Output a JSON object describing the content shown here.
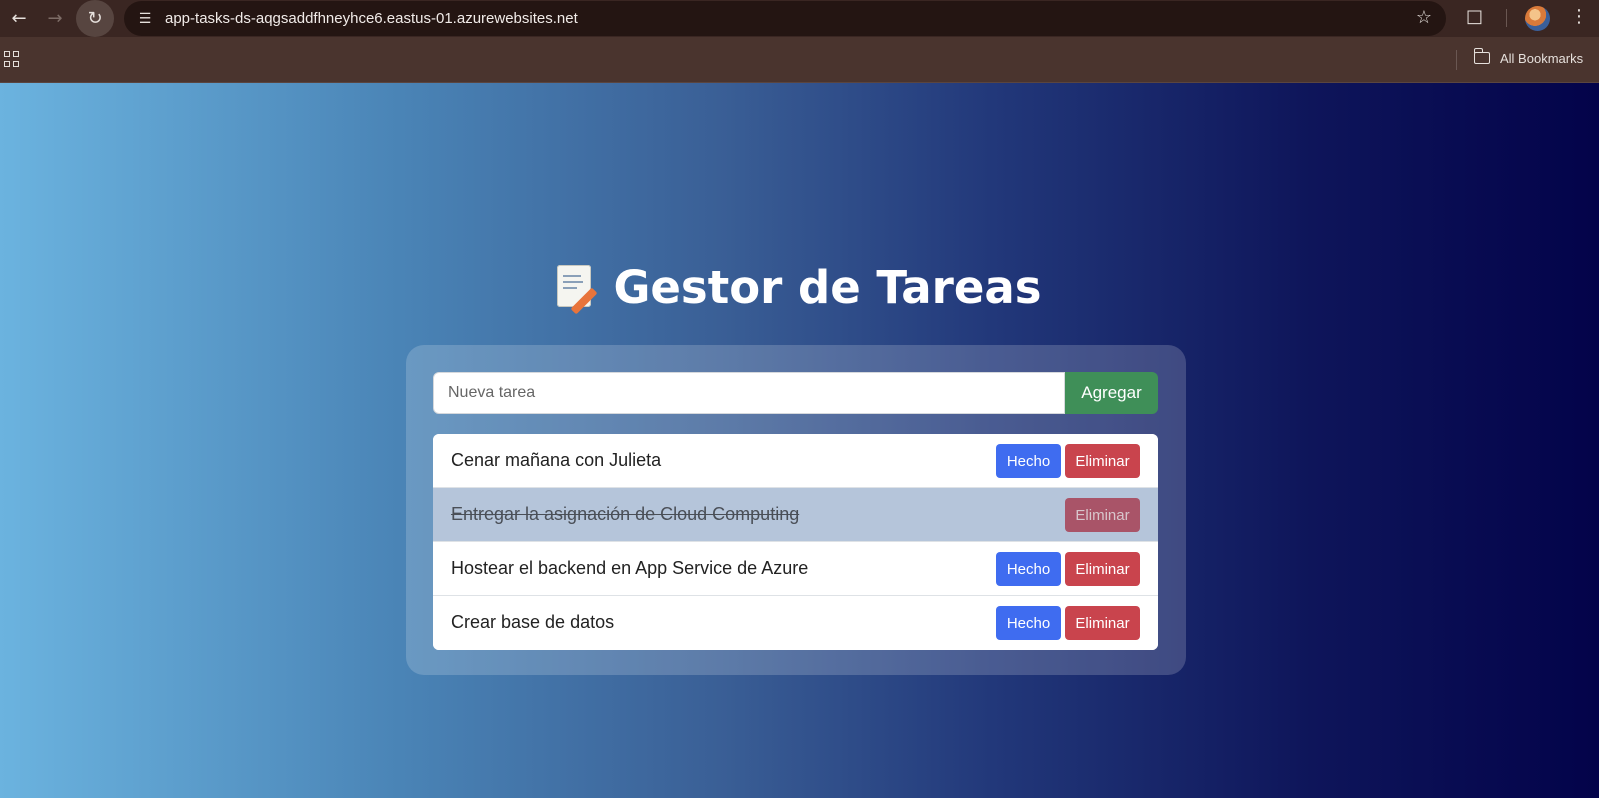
{
  "browser": {
    "url": "app-tasks-ds-aqgsaddfhneyhce6.eastus-01.azurewebsites.net",
    "all_bookmarks_label": "All Bookmarks"
  },
  "app": {
    "title": "Gestor de Tareas",
    "input_placeholder": "Nueva tarea",
    "input_value": "",
    "add_label": "Agregar"
  },
  "tasks": [
    {
      "text": "Cenar mañana con Julieta",
      "done": false,
      "done_label": "Hecho",
      "delete_label": "Eliminar"
    },
    {
      "text": "Entregar la asignación de Cloud Computing",
      "done": true,
      "done_label": "",
      "delete_label": "Eliminar"
    },
    {
      "text": "Hostear el backend en App Service de Azure",
      "done": false,
      "done_label": "Hecho",
      "delete_label": "Eliminar"
    },
    {
      "text": "Crear base de datos",
      "done": false,
      "done_label": "Hecho",
      "delete_label": "Eliminar"
    }
  ],
  "colors": {
    "add_button": "#3f8f58",
    "done_button": "#3f6cf0",
    "delete_button": "#c9444d",
    "completed_row": "#b5c5da"
  }
}
